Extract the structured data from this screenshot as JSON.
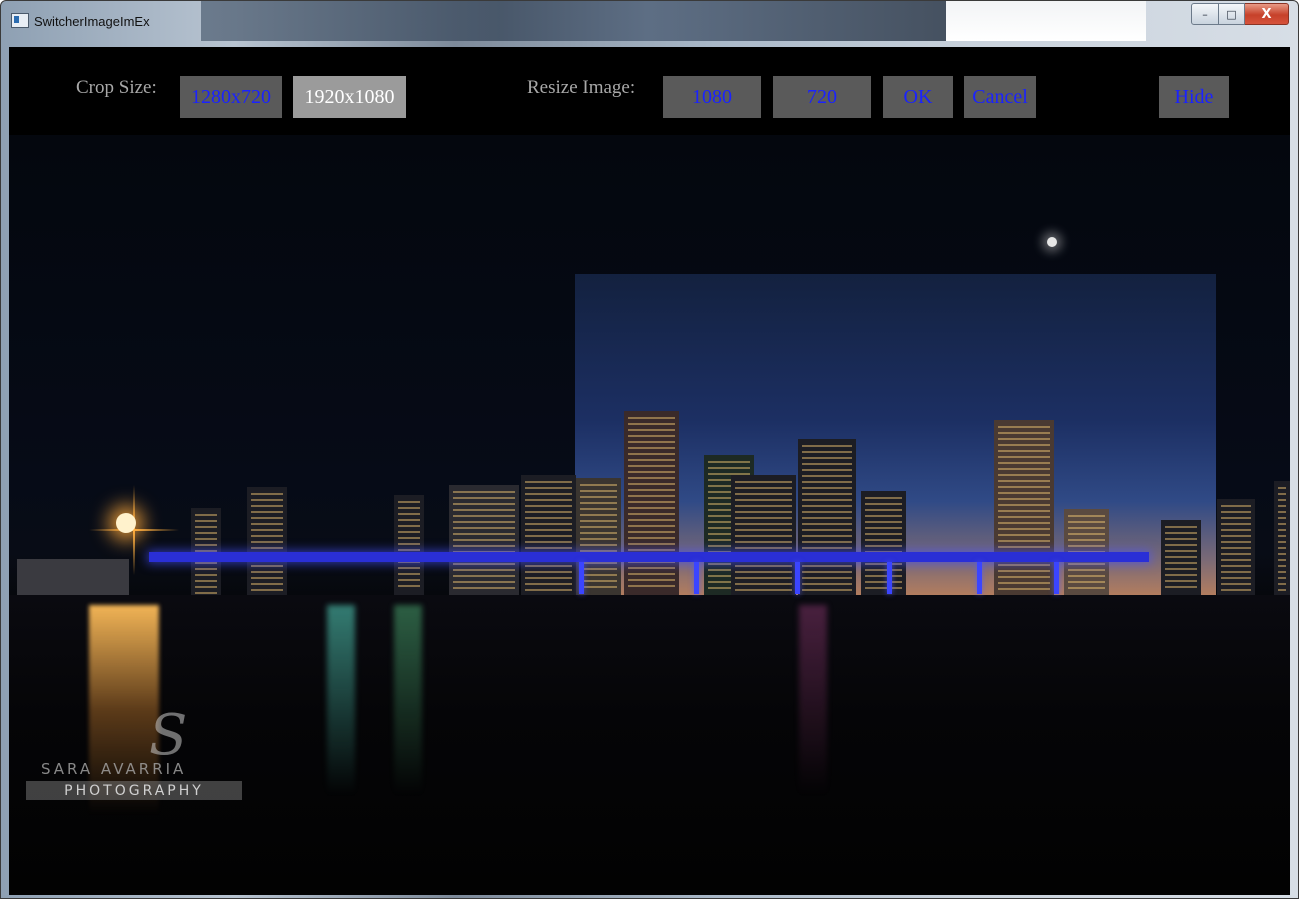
{
  "window": {
    "title": "SwitcherImageImEx",
    "minimize_label": "–",
    "maximize_label": "□",
    "close_label": "X"
  },
  "toolbar": {
    "crop_label": "Crop Size:",
    "crop_options": [
      "1280x720",
      "1920x1080"
    ],
    "crop_selected": "1920x1080",
    "resize_label": "Resize Image:",
    "resize_options": [
      "1080",
      "720"
    ],
    "ok_label": "OK",
    "cancel_label": "Cancel",
    "hide_label": "Hide"
  },
  "image": {
    "watermark_line1": "SARA AVARRIA",
    "watermark_line2": "PHOTOGRAPHY",
    "watermark_logo": "S"
  },
  "colors": {
    "button_bg": "#5a5a5a",
    "button_text": "#1a22ff",
    "button_selected_bg": "#9b9b9b",
    "label_text": "#a8a8a8"
  }
}
